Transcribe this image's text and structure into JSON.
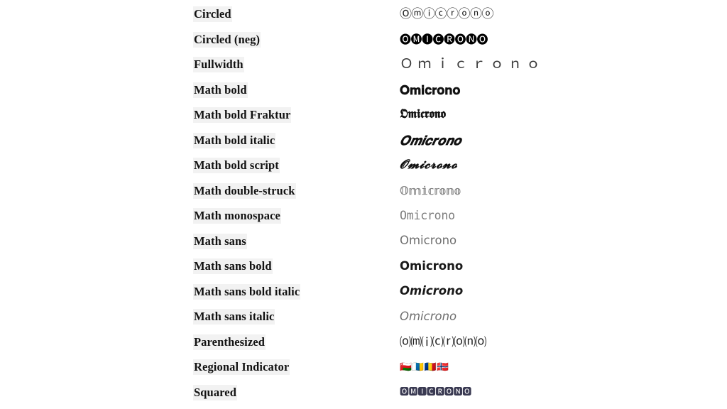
{
  "page": {
    "background_color": "#ffffff",
    "label_highlight_color": "#f2f2f2",
    "label_text_color": "#111111",
    "sample_word": "Omicrono",
    "row_count": 16
  },
  "rows": [
    {
      "label": "Circled",
      "value": "Ⓞⓜⓘⓒⓡⓞⓝⓞ",
      "style_key": "circled",
      "color": "#1d1d1d"
    },
    {
      "label": "Circled (neg)",
      "value": "🅞🅜🅘🅒🅡🅞🅝🅞",
      "style_key": "circled-neg",
      "color": "#000000"
    },
    {
      "label": "Fullwidth",
      "value": "Ｏｍｉｃｒｏｎｏ",
      "style_key": "fullwidth",
      "color": "#3a3a3a"
    },
    {
      "label": "Math bold",
      "value": "𝐎𝐦𝐢𝐜𝐫𝐨𝐧𝐨",
      "style_key": "math-bold",
      "color": "#121212"
    },
    {
      "label": "Math bold Fraktur",
      "value": "𝕺𝖒𝖎𝖈𝖗𝖔𝖓𝖔",
      "style_key": "math-bold-fraktur",
      "color": "#121212"
    },
    {
      "label": "Math bold italic",
      "value": "𝑶𝒎𝒊𝒄𝒓𝒐𝒏𝒐",
      "style_key": "math-bold-italic",
      "color": "#121212"
    },
    {
      "label": "Math bold script",
      "value": "𝓞𝓶𝓲𝓬𝓻𝓸𝓷𝓸",
      "style_key": "math-bold-script",
      "color": "#121212"
    },
    {
      "label": "Math double-struck",
      "value": "𝕆𝕞𝕚𝕔𝕣𝕠𝕟𝕠",
      "style_key": "math-double-struck",
      "color": "#8e8e8e"
    },
    {
      "label": "Math monospace",
      "value": "𝙾𝚖𝚒𝚌𝚛𝚘𝚗𝚘",
      "style_key": "math-monospace",
      "color": "#7d7d7d"
    },
    {
      "label": "Math sans",
      "value": "𝖮𝗆𝗂𝖼𝗋𝗈𝗇𝗈",
      "style_key": "math-sans",
      "color": "#6f6f6f"
    },
    {
      "label": "Math sans bold",
      "value": "𝗢𝗺𝗶𝗰𝗿𝗼𝗻𝗼",
      "style_key": "math-sans-bold",
      "color": "#1a1a1a"
    },
    {
      "label": "Math sans bold italic",
      "value": "𝙊𝙢𝙞𝙘𝙧𝙤𝙣𝙤",
      "style_key": "math-sans-bold-italic",
      "color": "#1a1a1a"
    },
    {
      "label": "Math sans italic",
      "value": "𝘖𝘮𝘪𝘤𝘳𝘰𝘯𝘰",
      "style_key": "math-sans-italic",
      "color": "#6f6f6f"
    },
    {
      "label": "Parenthesized",
      "value": "⒪⒨⒤⒞⒭⒪⒩⒪",
      "style_key": "parenthesized",
      "color": "#1f1f1f"
    },
    {
      "label": "Regional Indicator",
      "value": "🇴🇲🇮🇨🇷🇴🇳🇴",
      "style_key": "regional-indicator",
      "color": "#2a2a2a"
    },
    {
      "label": "Squared",
      "value": "🅾🅼🅸🅲🆁🅾🅽🅾",
      "style_key": "squared",
      "color": "#3a3a52"
    }
  ]
}
